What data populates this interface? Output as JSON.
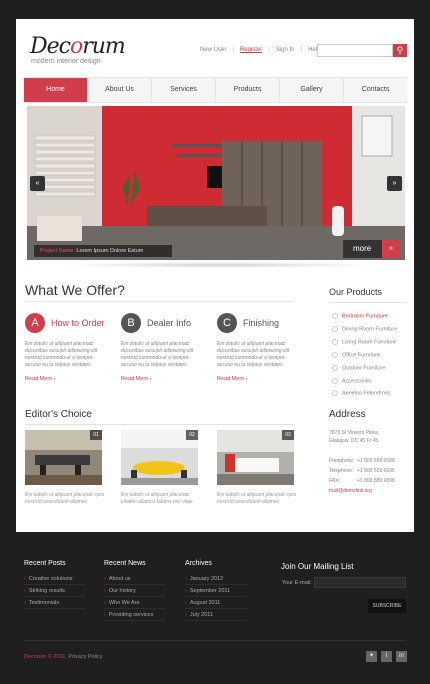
{
  "brand": {
    "logo_main": "Dec",
    "logo_accent": "o",
    "logo_rest": "rum",
    "tagline": "modern interior design"
  },
  "toplinks": {
    "new_user": "New User",
    "register": "Register",
    "sign_in": "Sign In",
    "help": "Help"
  },
  "search": {
    "placeholder": ""
  },
  "nav": [
    "Home",
    "About Us",
    "Services",
    "Products",
    "Gallery",
    "Contacts"
  ],
  "hero": {
    "caption_label": "Project Name:",
    "caption_text": "Lorem Ipsum Dolore Estum",
    "more": "more",
    "prev": "«",
    "next": "»"
  },
  "offer": {
    "title": "What We Offer?",
    "items": [
      {
        "letter": "A",
        "title": "How to Order",
        "text": "Eni octulis ut aliquam placetatc ducenibus suscipit adipiscing elit nostrud commodo ut si tempor accuso eu ta vulpius veritates",
        "more": "Read More"
      },
      {
        "letter": "B",
        "title": "Dealer Info",
        "text": "Eni octulis ut aliquam placetatc ducenibus suscipit adipiscing elit nostrud commodo ut si tempor accuso eu ta vulpius veritates",
        "more": "Read More"
      },
      {
        "letter": "C",
        "title": "Finishing",
        "text": "Eni octulis ut aliquam placetatc ducenibus suscipit adipiscing elit nostrud commodo ut si tempor accuso eu ta vulpius veritates",
        "more": "Read More"
      }
    ]
  },
  "editors": {
    "title": "Editor's Choice",
    "items": [
      {
        "num": "01",
        "text": "Eni octulis ut aliquam placetatc quis nostrud exercitation ullamco"
      },
      {
        "num": "02",
        "text": "Eni octulis ut aliquam placetatc citation ullamco laboris nisi utiqe"
      },
      {
        "num": "03",
        "text": "Eni octulis ut aliquam placetatc quis nostrud exercitation ullamco"
      }
    ]
  },
  "products": {
    "title": "Our Products",
    "items": [
      "Bedroom Furniture",
      "Dining Room Furniture",
      "Living Room Furniture",
      "Office Furniture",
      "Outdoor Furniture",
      "Accessories",
      "Aenelus Felendmes"
    ]
  },
  "address": {
    "title": "Address",
    "lines": [
      "7878 St Vincent Place,",
      "Glasgow, DC 45 Fr 45"
    ],
    "contacts": [
      {
        "label": "Freephone:",
        "value": "+1 800 559 6580"
      },
      {
        "label": "Telephone:",
        "value": "+1 800 603 6035"
      },
      {
        "label": "FAX:",
        "value": "+1 800 889 9898"
      }
    ],
    "email": "mail@demolink.org"
  },
  "footer": {
    "recent_posts": {
      "title": "Recent Posts",
      "items": [
        "Creative solutions",
        "Striking results",
        "Testimonials"
      ]
    },
    "recent_news": {
      "title": "Recent News",
      "items": [
        "About us",
        "Our history",
        "Who We Are",
        "Providing services"
      ]
    },
    "archives": {
      "title": "Archives",
      "items": [
        "January 2012",
        "September 2011",
        "August 2011",
        "July 2011"
      ]
    },
    "mailing": {
      "title": "Join Our Mailing List",
      "label": "Your E-mail:",
      "button": "SUBSCRIBE"
    },
    "copyright": "Decorum © 2011",
    "privacy": "Privacy Policy",
    "social": [
      "✦",
      "t",
      "in"
    ]
  },
  "colors": {
    "accent": "#d03d4b",
    "dark": "#1f1f1f",
    "circle_b": "#555555"
  }
}
